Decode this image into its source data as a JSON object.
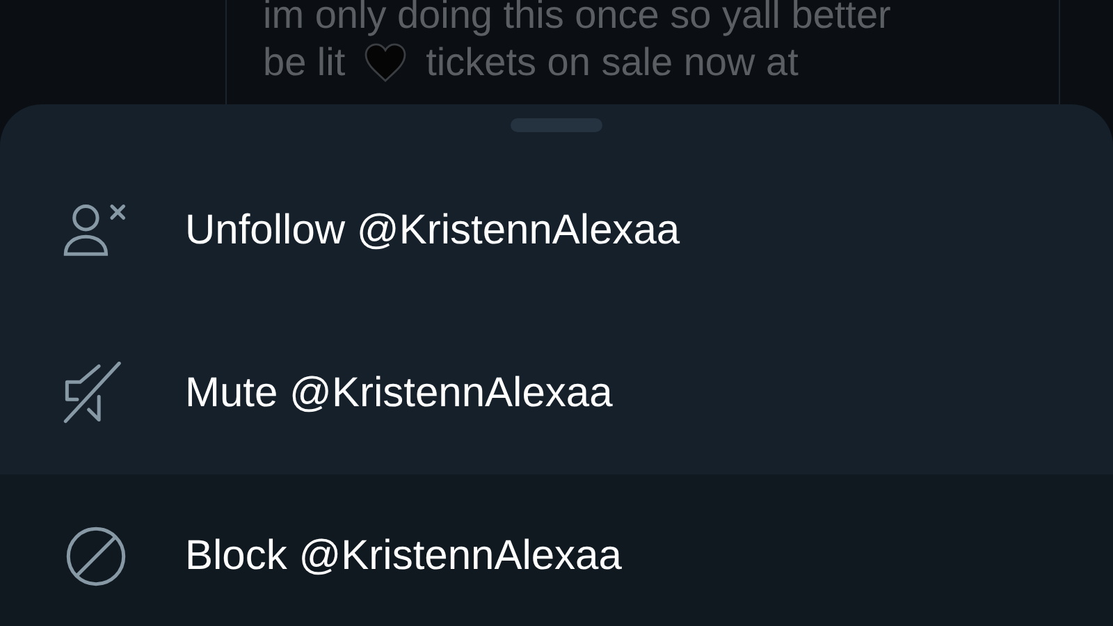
{
  "tweet": {
    "lines": [
      "im only doing this once so yall better",
      "be lit",
      {
        "kind": "heart"
      },
      "tickets on sale now at"
    ]
  },
  "sheet": {
    "items": [
      {
        "kind": "unfollow",
        "label": "Unfollow @KristennAlexaa"
      },
      {
        "kind": "mute",
        "label": "Mute @KristennAlexaa"
      },
      {
        "kind": "block",
        "label": "Block @KristennAlexaa"
      }
    ]
  }
}
